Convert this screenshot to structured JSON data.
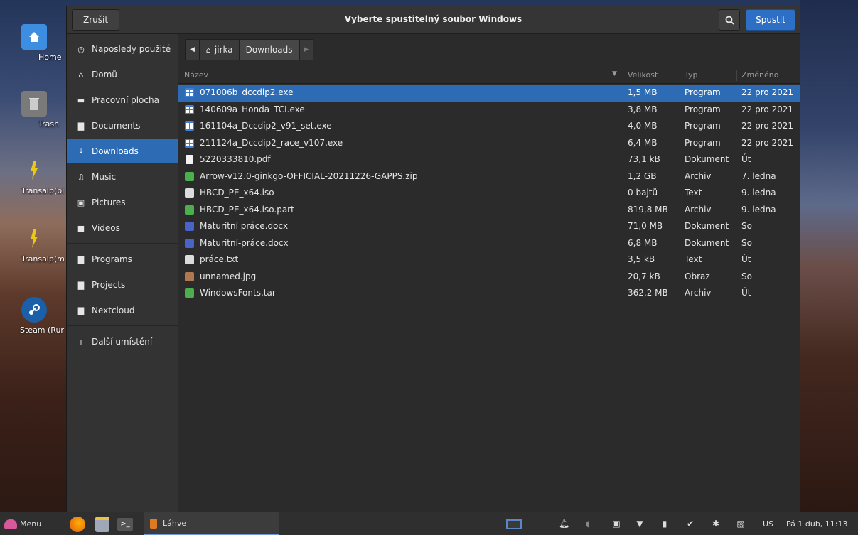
{
  "desktop": {
    "icons": [
      {
        "label": "Home",
        "icon": "home-folder-icon",
        "color": "#3d8de0"
      },
      {
        "label": "Trash",
        "icon": "trash-icon",
        "color": "#8a8a8a"
      },
      {
        "label": "Transalp(bi",
        "icon": "bike-icon",
        "color": "#e0c020"
      },
      {
        "label": "Transalp(m",
        "icon": "bike-icon",
        "color": "#e0c020"
      },
      {
        "label": "Steam (Rur",
        "icon": "steam-icon",
        "color": "#1b5fa8"
      }
    ]
  },
  "dialog": {
    "title": "Vyberte spustitelný soubor Windows",
    "cancel_label": "Zrušit",
    "run_label": "Spustit",
    "search_icon": "search-icon"
  },
  "sidebar": {
    "items": [
      {
        "label": "Naposledy použité",
        "icon": "clock-icon",
        "glyph": "◷"
      },
      {
        "label": "Domů",
        "icon": "home-icon",
        "glyph": "⌂"
      },
      {
        "label": "Pracovní plocha",
        "icon": "desktop-icon",
        "glyph": "▬"
      },
      {
        "label": "Documents",
        "icon": "document-icon",
        "glyph": "▇"
      },
      {
        "label": "Downloads",
        "icon": "download-icon",
        "glyph": "⤓",
        "active": true
      },
      {
        "label": "Music",
        "icon": "music-icon",
        "glyph": "♫"
      },
      {
        "label": "Pictures",
        "icon": "picture-icon",
        "glyph": "▣"
      },
      {
        "label": "Videos",
        "icon": "video-icon",
        "glyph": "■"
      },
      {
        "label": "Programs",
        "icon": "folder-icon",
        "glyph": "▇"
      },
      {
        "label": "Projects",
        "icon": "folder-icon",
        "glyph": "▇"
      },
      {
        "label": "Nextcloud",
        "icon": "folder-icon",
        "glyph": "▇"
      },
      {
        "label": "Další umístění",
        "icon": "plus-icon",
        "glyph": "+"
      }
    ]
  },
  "pathbar": {
    "segments": [
      "jirka",
      "Downloads"
    ]
  },
  "columns": {
    "name": "Název",
    "size": "Velikost",
    "type": "Typ",
    "modified": "Změněno"
  },
  "files": [
    {
      "name": "071006b_dccdip2.exe",
      "size": "1,5 MB",
      "type": "Program",
      "modified": "22 pro 2021",
      "kind": "exe",
      "selected": true
    },
    {
      "name": "140609a_Honda_TCI.exe",
      "size": "3,8 MB",
      "type": "Program",
      "modified": "22 pro 2021",
      "kind": "exe"
    },
    {
      "name": "161104a_Dccdip2_v91_set.exe",
      "size": "4,0 MB",
      "type": "Program",
      "modified": "22 pro 2021",
      "kind": "exe"
    },
    {
      "name": "211124a_Dccdip2_race_v107.exe",
      "size": "6,4 MB",
      "type": "Program",
      "modified": "22 pro 2021",
      "kind": "exe"
    },
    {
      "name": "5220333810.pdf",
      "size": "73,1 kB",
      "type": "Dokument",
      "modified": "Út",
      "kind": "pdf"
    },
    {
      "name": "Arrow-v12.0-ginkgo-OFFICIAL-20211226-GAPPS.zip",
      "size": "1,2 GB",
      "type": "Archiv",
      "modified": "7. ledna",
      "kind": "zip"
    },
    {
      "name": "HBCD_PE_x64.iso",
      "size": "0 bajtů",
      "type": "Text",
      "modified": "9. ledna",
      "kind": "txt"
    },
    {
      "name": "HBCD_PE_x64.iso.part",
      "size": "819,8 MB",
      "type": "Archiv",
      "modified": "9. ledna",
      "kind": "zip"
    },
    {
      "name": "Maturitní práce.docx",
      "size": "71,0 MB",
      "type": "Dokument",
      "modified": "So",
      "kind": "doc"
    },
    {
      "name": "Maturitní-práce.docx",
      "size": "6,8 MB",
      "type": "Dokument",
      "modified": "So",
      "kind": "doc"
    },
    {
      "name": "práce.txt",
      "size": "3,5 kB",
      "type": "Text",
      "modified": "Út",
      "kind": "txt"
    },
    {
      "name": "unnamed.jpg",
      "size": "20,7 kB",
      "type": "Obraz",
      "modified": "So",
      "kind": "img"
    },
    {
      "name": "WindowsFonts.tar",
      "size": "362,2 MB",
      "type": "Archiv",
      "modified": "Út",
      "kind": "zip"
    }
  ],
  "taskbar": {
    "menu_label": "Menu",
    "task_label": "Láhve",
    "keyboard_layout": "US",
    "clock": "Pá 1 dub, 11:13"
  },
  "colors": {
    "accent": "#2d6cb5",
    "run_button": "#2d6fc4"
  }
}
